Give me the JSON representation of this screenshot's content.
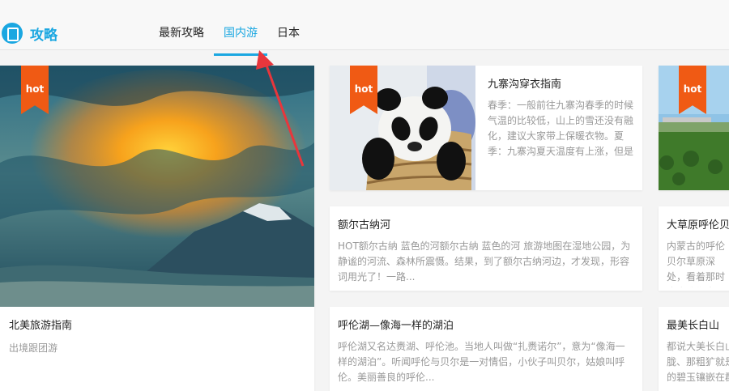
{
  "logo": {
    "text": "攻略"
  },
  "tabs": [
    "最新攻略",
    "国内游",
    "日本"
  ],
  "badge": "hot",
  "cards": {
    "feature": {
      "title": "北美旅游指南",
      "subtitle": "出境跟团游"
    },
    "panda": {
      "title": "九寨沟穿衣指南",
      "desc": "春季：一般前往九寨沟春季的时候气温的比较低，山上的雪还没有融化，建议大家带上保暖衣物。夏季：九寨沟夏天温度有上涨，但是"
    },
    "grassland_top": {},
    "erguna": {
      "title": "额尔古纳河",
      "desc": "HOT额尔古纳 蓝色的河额尔古纳 蓝色的河 旅游地图在湿地公园，为静谧的河流、森林所震慑。结果，到了额尔古纳河边，才发现，形容词用光了！一路..."
    },
    "grassland": {
      "title": "大草原呼伦贝",
      "desc": "内蒙古的呼伦贝尔草原深处，看着那时也许我们真"
    },
    "hulun": {
      "title": "呼伦湖—像海一样的湖泊",
      "desc": "呼伦湖又名达赉湖、呼伦池。当地人叫做“扎赉诺尔”，意为“像海一样的湖泊”。听闻呼伦与贝尔是一对情侣，小伙子叫贝尔，姑娘叫呼伦。美丽善良的呼伦..."
    },
    "changbai": {
      "title": "最美长白山",
      "desc": "都说大美长白山胧、那粗犷就是的碧玉镶嵌在群"
    }
  },
  "colors": {
    "accent": "#1ba7e1",
    "hot": "#f05a14",
    "arrow": "#e8363c"
  }
}
